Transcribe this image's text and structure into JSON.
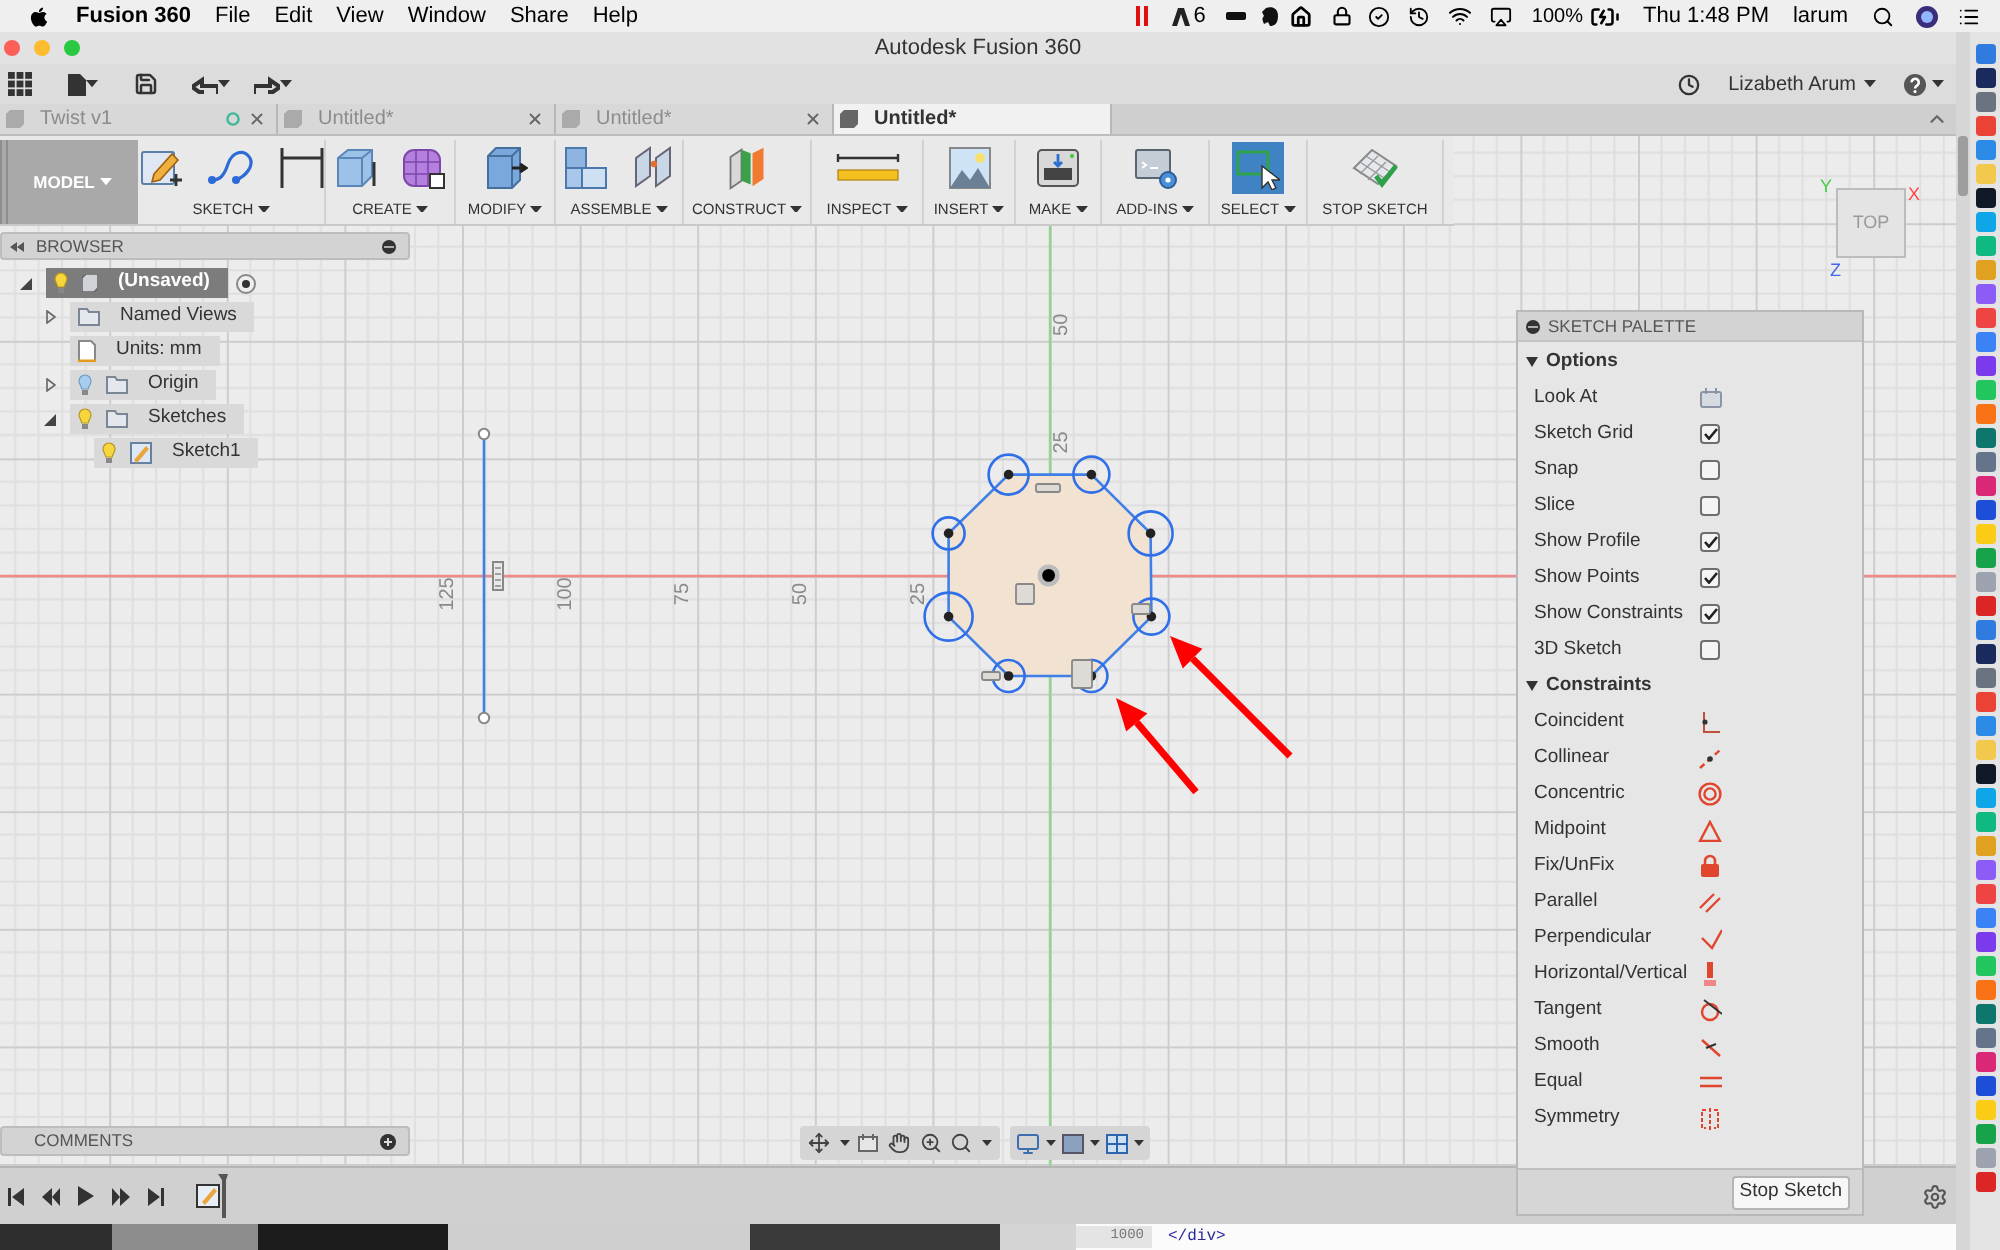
{
  "menu_bar": {
    "app_name": "Fusion 360",
    "menus": [
      "File",
      "Edit",
      "View",
      "Window",
      "Share",
      "Help"
    ],
    "status": {
      "badge_count": "6",
      "battery": "100%",
      "clock": "Thu 1:48 PM",
      "user": "larum"
    }
  },
  "window": {
    "title": "Autodesk Fusion 360"
  },
  "quick_access": {
    "user": "Lizabeth Arum"
  },
  "tabs": [
    {
      "label": "Twist v1",
      "selected": false,
      "status_ring": true
    },
    {
      "label": "Untitled*",
      "selected": false,
      "status_ring": false
    },
    {
      "label": "Untitled*",
      "selected": false,
      "status_ring": false
    },
    {
      "label": "Untitled*",
      "selected": true,
      "status_ring": false
    }
  ],
  "ribbon": {
    "workspace": "MODEL",
    "groups": [
      {
        "label": "SKETCH",
        "dropdown": true,
        "selected": false
      },
      {
        "label": "CREATE",
        "dropdown": true,
        "selected": false
      },
      {
        "label": "MODIFY",
        "dropdown": true,
        "selected": false
      },
      {
        "label": "ASSEMBLE",
        "dropdown": true,
        "selected": false
      },
      {
        "label": "CONSTRUCT",
        "dropdown": true,
        "selected": false
      },
      {
        "label": "INSPECT",
        "dropdown": true,
        "selected": false
      },
      {
        "label": "INSERT",
        "dropdown": true,
        "selected": false
      },
      {
        "label": "MAKE",
        "dropdown": true,
        "selected": false
      },
      {
        "label": "ADD-INS",
        "dropdown": true,
        "selected": false
      },
      {
        "label": "SELECT",
        "dropdown": true,
        "selected": true
      },
      {
        "label": "STOP SKETCH",
        "dropdown": false,
        "selected": false
      }
    ]
  },
  "browser": {
    "title": "BROWSER",
    "tree": [
      {
        "label": "(Unsaved)",
        "kind": "component",
        "visible": true,
        "selected": true,
        "expanded": true,
        "children": [
          {
            "label": "Named Views",
            "kind": "folder",
            "selected": false,
            "expanded": false
          },
          {
            "label": "Units: mm",
            "kind": "units",
            "selected": false
          },
          {
            "label": "Origin",
            "kind": "folder",
            "visible": false,
            "selected": false,
            "expanded": false
          },
          {
            "label": "Sketches",
            "kind": "folder",
            "visible": true,
            "selected": false,
            "expanded": true,
            "children": [
              {
                "label": "Sketch1",
                "kind": "sketch",
                "visible": true,
                "selected": false
              }
            ]
          }
        ]
      }
    ]
  },
  "canvas": {
    "x_axis_labels": [
      "125",
      "100",
      "75",
      "50",
      "25"
    ],
    "y_axis_labels": [
      "50",
      "25"
    ]
  },
  "view_cube": {
    "face": "TOP",
    "axes": [
      {
        "label": "Y",
        "color": "#44cc44"
      },
      {
        "label": "X",
        "color": "#ff4444"
      },
      {
        "label": "Z",
        "color": "#4466ee"
      }
    ]
  },
  "sketch_palette": {
    "title": "SKETCH PALETTE",
    "sections": [
      {
        "title": "Options",
        "expanded": true,
        "rows": [
          {
            "label": "Look At",
            "kind": "button"
          },
          {
            "label": "Sketch Grid",
            "kind": "checkbox",
            "checked": true
          },
          {
            "label": "Snap",
            "kind": "checkbox",
            "checked": false
          },
          {
            "label": "Slice",
            "kind": "checkbox",
            "checked": false
          },
          {
            "label": "Show Profile",
            "kind": "checkbox",
            "checked": true
          },
          {
            "label": "Show Points",
            "kind": "checkbox",
            "checked": true
          },
          {
            "label": "Show Constraints",
            "kind": "checkbox",
            "checked": true
          },
          {
            "label": "3D Sketch",
            "kind": "checkbox",
            "checked": false
          }
        ]
      },
      {
        "title": "Constraints",
        "expanded": true,
        "rows": [
          {
            "label": "Coincident",
            "kind": "constraint"
          },
          {
            "label": "Collinear",
            "kind": "constraint"
          },
          {
            "label": "Concentric",
            "kind": "constraint"
          },
          {
            "label": "Midpoint",
            "kind": "constraint"
          },
          {
            "label": "Fix/UnFix",
            "kind": "constraint"
          },
          {
            "label": "Parallel",
            "kind": "constraint"
          },
          {
            "label": "Perpendicular",
            "kind": "constraint"
          },
          {
            "label": "Horizontal/Vertical",
            "kind": "constraint"
          },
          {
            "label": "Tangent",
            "kind": "constraint"
          },
          {
            "label": "Smooth",
            "kind": "constraint"
          },
          {
            "label": "Equal",
            "kind": "constraint"
          },
          {
            "label": "Symmetry",
            "kind": "constraint"
          }
        ]
      }
    ],
    "button": "Stop Sketch"
  },
  "comments": {
    "title": "COMMENTS"
  },
  "background_windows": {
    "line_number": "1000",
    "code": "</div>"
  }
}
